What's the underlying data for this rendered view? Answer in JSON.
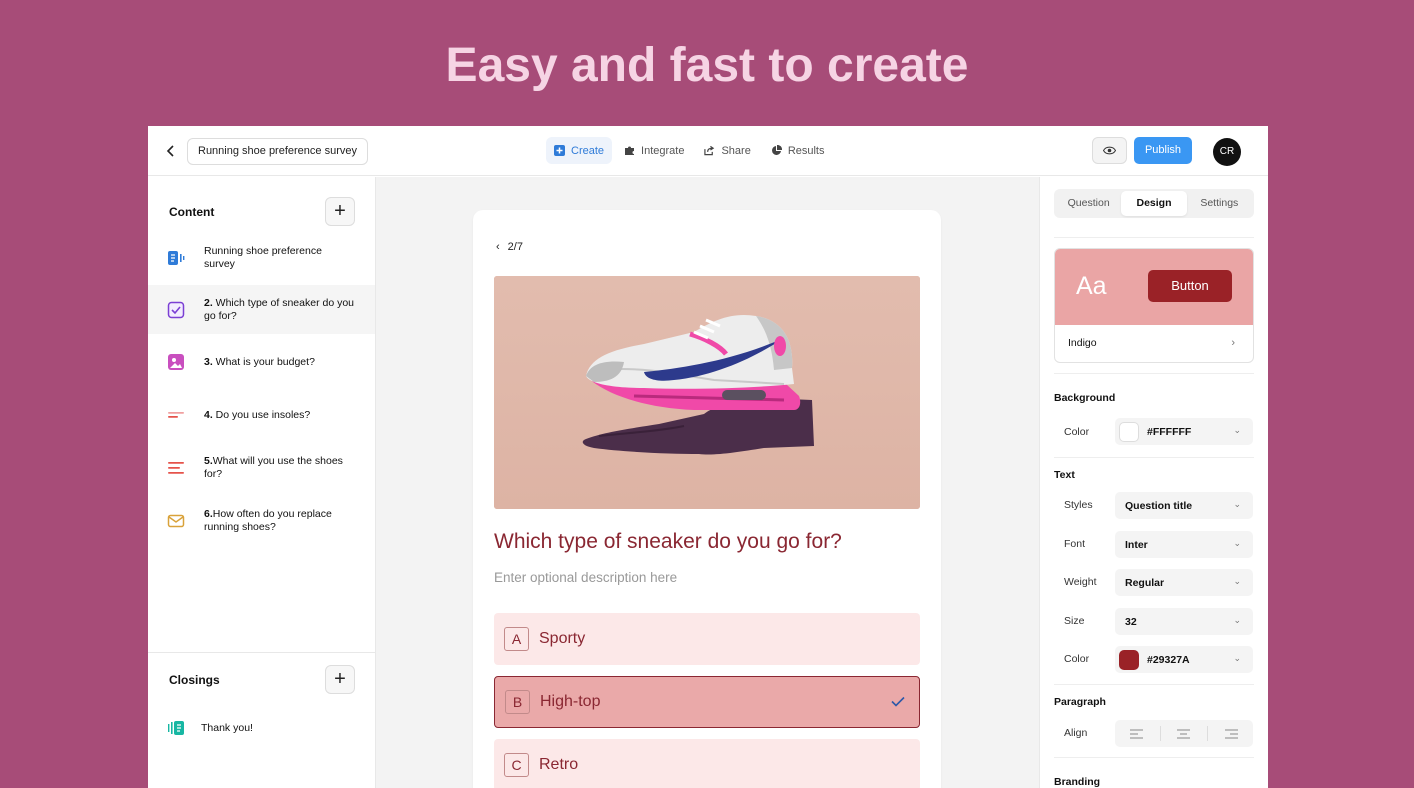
{
  "headline": "Easy and fast to create",
  "topbar": {
    "survey_name": "Running shoe preference survey",
    "tabs": [
      {
        "label": "Create",
        "icon": "plus-square-icon",
        "active": true
      },
      {
        "label": "Integrate",
        "icon": "puzzle-icon",
        "active": false
      },
      {
        "label": "Share",
        "icon": "share-icon",
        "active": false
      },
      {
        "label": "Results",
        "icon": "pie-chart-icon",
        "active": false
      }
    ],
    "publish_label": "Publish",
    "avatar_initials": "CR"
  },
  "content": {
    "title": "Content",
    "items": [
      {
        "num": "",
        "label": "Running shoe preference survey",
        "icon": "welcome-screen-icon",
        "color": "#2f7bd8"
      },
      {
        "num": "2.",
        "label": " Which type of sneaker do you go for?",
        "icon": "checkbox-icon",
        "color": "#7b3fd4"
      },
      {
        "num": "3.",
        "label": " What is your budget?",
        "icon": "picture-choice-icon",
        "color": "#c94fbf"
      },
      {
        "num": "4.",
        "label": " Do you use insoles?",
        "icon": "short-text-icon",
        "color": "#e5534b"
      },
      {
        "num": "5.",
        "label": "What will you use the shoes for?",
        "icon": "long-text-icon",
        "color": "#e5534b"
      },
      {
        "num": "6.",
        "label": "How often do you replace running shoes?",
        "icon": "email-icon",
        "color": "#d9a23a"
      }
    ]
  },
  "closings": {
    "title": "Closings",
    "items": [
      {
        "label": "Thank you!",
        "icon": "ending-screen-icon",
        "color": "#17b7a3"
      }
    ]
  },
  "question": {
    "pager": "2/7",
    "title": "Which type of sneaker do you go for?",
    "description": "Enter optional description here",
    "choices": [
      {
        "letter": "A",
        "text": "Sporty",
        "selected": false
      },
      {
        "letter": "B",
        "text": "High-top",
        "selected": true
      },
      {
        "letter": "C",
        "text": "Retro",
        "selected": false
      }
    ]
  },
  "design": {
    "tabs": [
      "Question",
      "Design",
      "Settings"
    ],
    "active_tab": "Design",
    "theme": {
      "sample_text": "Aa",
      "button_label": "Button",
      "name": "Indigo"
    },
    "background": {
      "heading": "Background",
      "color_label": "Color",
      "color_value": "#FFFFFF"
    },
    "text": {
      "heading": "Text",
      "styles_label": "Styles",
      "styles_value": "Question title",
      "font_label": "Font",
      "font_value": "Inter",
      "weight_label": "Weight",
      "weight_value": "Regular",
      "size_label": "Size",
      "size_value": "32",
      "color_label": "Color",
      "color_value": "#29327A"
    },
    "paragraph": {
      "heading": "Paragraph",
      "align_label": "Align"
    },
    "branding": {
      "heading": "Branding"
    }
  },
  "colors": {
    "background": "#a74c78",
    "accent": "#3a97f3",
    "question_text": "#8a2732",
    "theme_button": "#9a2227",
    "text_swatch": "#9a2227"
  }
}
